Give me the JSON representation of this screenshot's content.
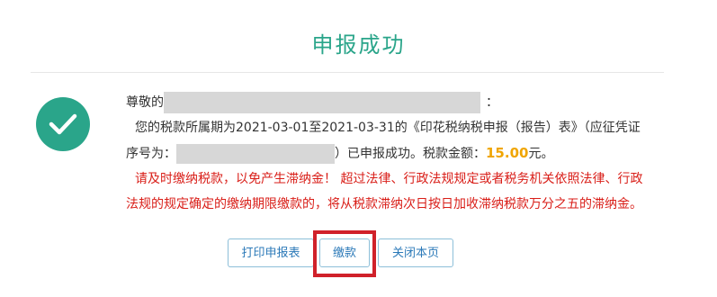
{
  "page": {
    "title": "申报成功"
  },
  "message": {
    "greeting_prefix": "尊敬的",
    "greeting_suffix": "：",
    "line2": "您的税款所属期为2021-03-01至2021-03-31的《印花税纳税申报（报告）表》（应征凭证",
    "line3_prefix": "序号为：",
    "line3_suffix": "）已申报成功。税款金额：",
    "amount": "15.00",
    "amount_unit": "元。",
    "warning_line1": "请及时缴纳税款，以免产生滞纳金！ 超过法律、行政法规规定或者税务机关依照法律、行政",
    "warning_line2": "法规的规定确定的缴纳期限缴款的，将从税款滞纳次日按日加收滞纳税款万分之五的滞纳金。"
  },
  "buttons": {
    "print": "打印申报表",
    "pay": "缴款",
    "close": "关闭本页"
  },
  "colors": {
    "accent": "#2aa58a",
    "amount": "#f0a500",
    "warning": "#d91e18",
    "button_text": "#2b79b8",
    "highlight": "#d0212a"
  },
  "icons": {
    "success": "check-circle-icon"
  }
}
